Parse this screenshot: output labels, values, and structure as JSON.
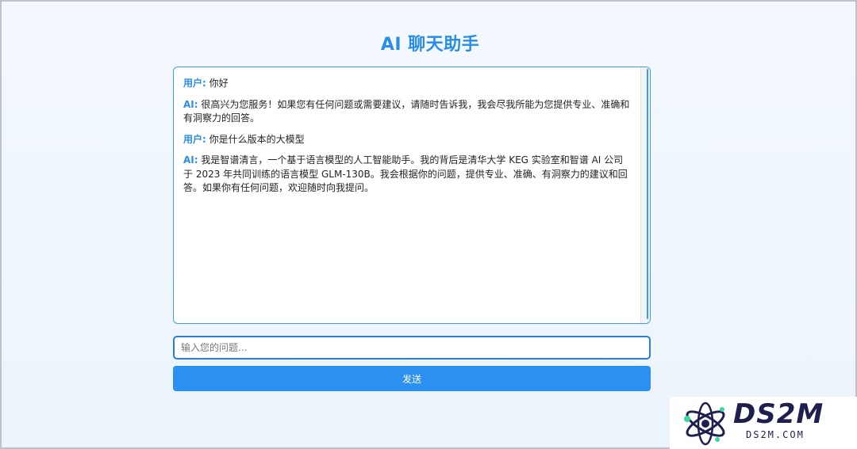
{
  "page": {
    "title": "AI 聊天助手"
  },
  "chat": {
    "messages": [
      {
        "role": "用户:",
        "text": "你好"
      },
      {
        "role": "AI:",
        "text": "很高兴为您服务！如果您有任何问题或需要建议，请随时告诉我，我会尽我所能为您提供专业、准确和有洞察力的回答。"
      },
      {
        "role": "用户:",
        "text": "你是什么版本的大模型"
      },
      {
        "role": "AI:",
        "text": "我是智谱清言，一个基于语言模型的人工智能助手。我的背后是清华大学 KEG 实验室和智谱 AI 公司于 2023 年共同训练的语言模型 GLM-130B。我会根据你的问题，提供专业、准确、有洞察力的建议和回答。如果你有任何问题，欢迎随时向我提问。"
      }
    ]
  },
  "input": {
    "placeholder": "输入您的问题..."
  },
  "send_button": {
    "label": "发送"
  },
  "watermark": {
    "brand": "DS2M",
    "url": "DS2M.COM"
  },
  "colors": {
    "accent": "#2a8de6",
    "button": "#2b90f0",
    "background": "#eef5fd",
    "border": "#3d9be9"
  }
}
